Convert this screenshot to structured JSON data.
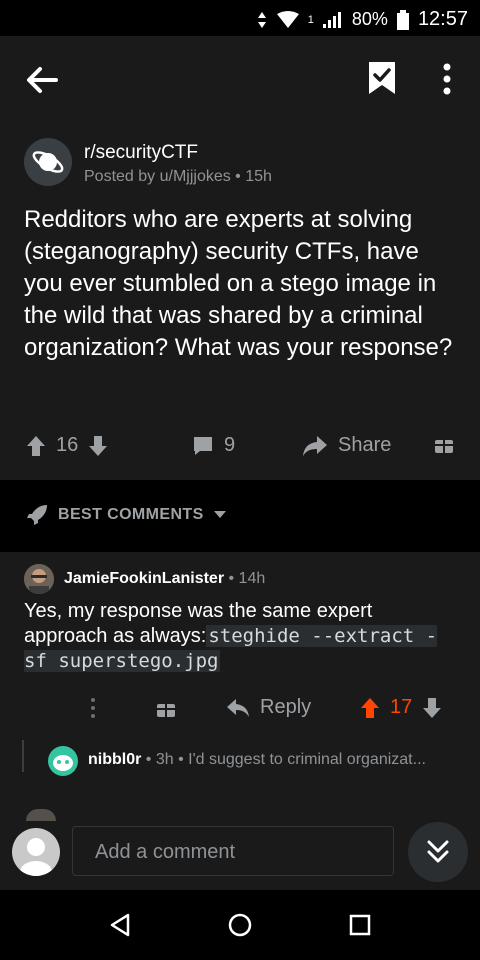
{
  "statusbar": {
    "network_num": "1",
    "battery_pct": "80%",
    "time": "12:57"
  },
  "post": {
    "subreddit": "r/securityCTF",
    "meta": "Posted by u/Mjjjokes • 15h",
    "title": "Redditors who are experts at solving (steganography) security CTFs, have you ever stumbled on a stego image in the wild that was shared by a criminal organization? What was your response?",
    "score": "16",
    "comments": "9",
    "share_label": "Share"
  },
  "section": {
    "label": "BEST COMMENTS"
  },
  "comment": {
    "author": "JamieFookinLanister",
    "time": " • 14h",
    "body_text": "Yes, my response was the same expert approach as always:",
    "body_code": "steghide --extract -sf superstego.jpg",
    "reply_label": "Reply",
    "score": "17"
  },
  "reply_preview": {
    "author": "nibbl0r",
    "rest": " • 3h • I'd suggest to criminal organizat..."
  },
  "composer": {
    "placeholder": "Add a comment"
  },
  "colors": {
    "upvote_active": "#ff4500",
    "background": "#1a1a1b",
    "bar": "#000000"
  }
}
